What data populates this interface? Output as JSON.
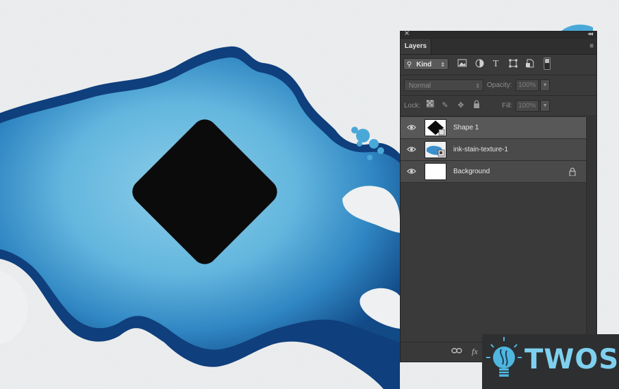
{
  "colors": {
    "ink_dark": "#0e3f7a",
    "ink_mid": "#2a7fbd",
    "ink_light": "#7cc4e6",
    "shape_fill": "#0b0b0b",
    "panel_bg": "#3a3a3a",
    "selected_row": "#585858",
    "logo_accent": "#7fd0ee"
  },
  "panel": {
    "title_controls": {
      "close": "✕",
      "collapse": "◂◂"
    },
    "tab_label": "Layers",
    "menu_icon": "≡",
    "filter": {
      "kind_label": "Kind",
      "icons": [
        "pixel-filter-icon",
        "adjustment-filter-icon",
        "type-filter-icon",
        "shape-filter-icon",
        "smart-object-filter-icon",
        "filter-toggle-icon"
      ]
    },
    "blend_mode": "Normal",
    "opacity_label": "Opacity:",
    "opacity_value": "100%",
    "lock_label": "Lock:",
    "lock_icons": [
      "lock-transparent-icon",
      "lock-image-icon",
      "lock-position-icon",
      "lock-all-icon"
    ],
    "fill_label": "Fill:",
    "fill_value": "100%",
    "layers": [
      {
        "name": "Shape 1",
        "selected": true,
        "visible": true
      },
      {
        "name": "ink-stain-texture-1",
        "selected": false,
        "visible": true
      },
      {
        "name": "Background",
        "selected": false,
        "visible": true,
        "locked": true
      }
    ],
    "footer_icons": [
      "link-icon",
      "fx-icon"
    ],
    "footer_fx_label": "fx"
  },
  "watermark": {
    "text": "TWOS"
  }
}
